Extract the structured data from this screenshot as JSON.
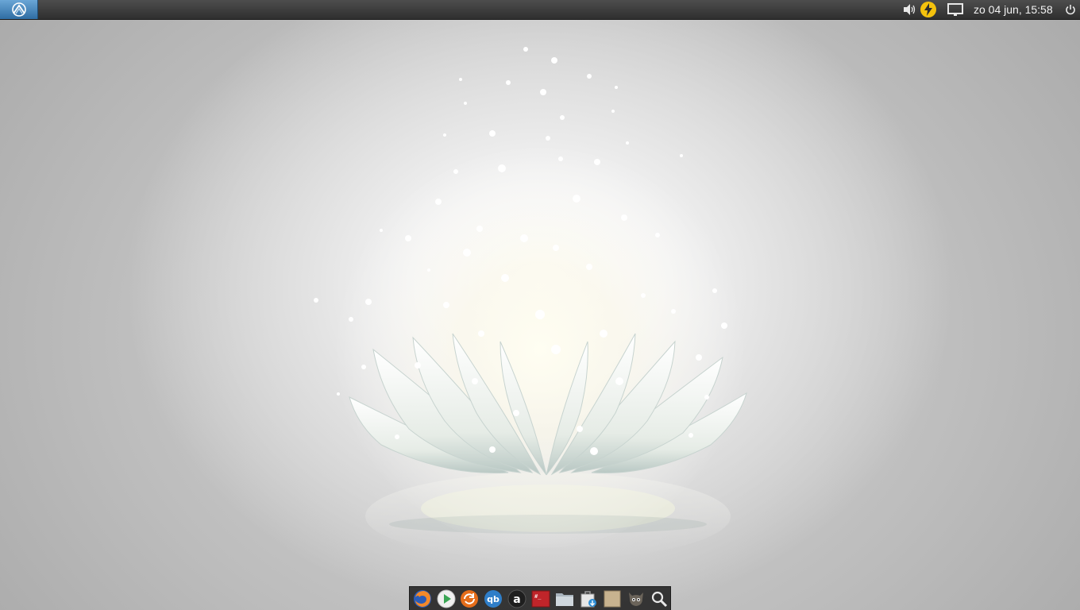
{
  "top_panel": {
    "clock": "zo 04 jun, 15:58",
    "tray_icons": [
      "volume-icon",
      "power-manager-icon",
      "network-display-icon",
      "shutdown-icon"
    ],
    "menu_icon": "app-menu-icon"
  },
  "dock": {
    "items": [
      {
        "icon": "firefox-icon"
      },
      {
        "icon": "media-player-icon"
      },
      {
        "icon": "software-updater-icon"
      },
      {
        "icon": "qbittorrent-icon"
      },
      {
        "icon": "app-store-icon"
      },
      {
        "icon": "terminal-icon"
      },
      {
        "icon": "file-manager-icon"
      },
      {
        "icon": "software-center-icon"
      },
      {
        "icon": "blank-app-icon"
      },
      {
        "icon": "gimp-icon"
      },
      {
        "icon": "search-icon"
      }
    ]
  },
  "colors": {
    "panel": "#3a3a3a",
    "menu_button": "#3f82be",
    "power_badge": "#f4c20d",
    "dock": "#282828"
  }
}
